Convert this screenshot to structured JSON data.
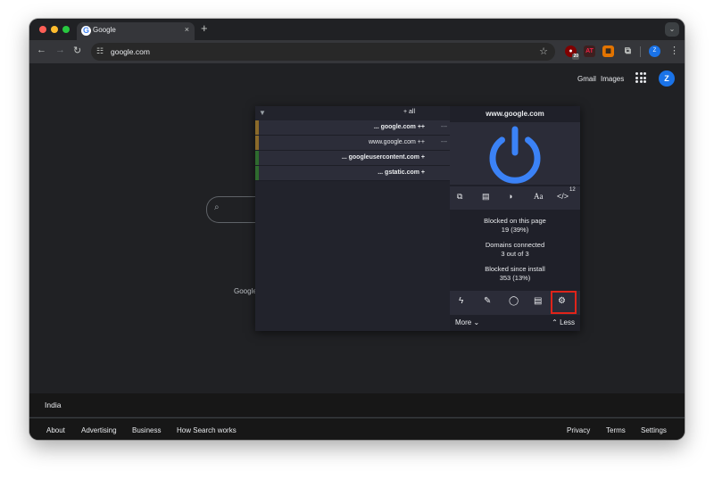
{
  "browser": {
    "tab_title": "Google",
    "tab_close": "×",
    "new_tab": "+",
    "tab_menu": "⌄",
    "url": "google.com",
    "colors": {
      "close": "#ff5f57",
      "minimize": "#febc2e",
      "zoom": "#28c840"
    },
    "extension_badge": "20",
    "profile_initial": "Z"
  },
  "google": {
    "gmail": "Gmail",
    "images": "Images",
    "avatar_initial": "Z",
    "search_label": "Google",
    "footer_country": "India",
    "footer_left": [
      "About",
      "Advertising",
      "Business",
      "How Search works"
    ],
    "footer_right": [
      "Privacy",
      "Terms",
      "Settings"
    ]
  },
  "ublock": {
    "hostname": "www.google.com",
    "all_label": "+ all",
    "domains": [
      {
        "label": "... google.com ++",
        "dash": "---",
        "color": "#8a6a2a",
        "bold": true
      },
      {
        "label": "www.google.com ++",
        "dash": "---",
        "color": "#8a6a2a",
        "bold": false
      },
      {
        "label": "... googleusercontent.com +",
        "dash": "",
        "color": "#2e6b2e",
        "bold": true
      },
      {
        "label": "... gstatic.com +",
        "dash": "",
        "color": "#2e6b2e",
        "bold": true
      }
    ],
    "script_count": "12",
    "stats": {
      "blocked_page_label": "Blocked on this page",
      "blocked_page_value": "19 (39%)",
      "domains_label": "Domains connected",
      "domains_value": "3 out of 3",
      "blocked_install_label": "Blocked since install",
      "blocked_install_value": "353 (13%)"
    },
    "more": "More",
    "less": "Less",
    "power_color": "#3b82f6",
    "highlight_color": "#e0241a"
  }
}
